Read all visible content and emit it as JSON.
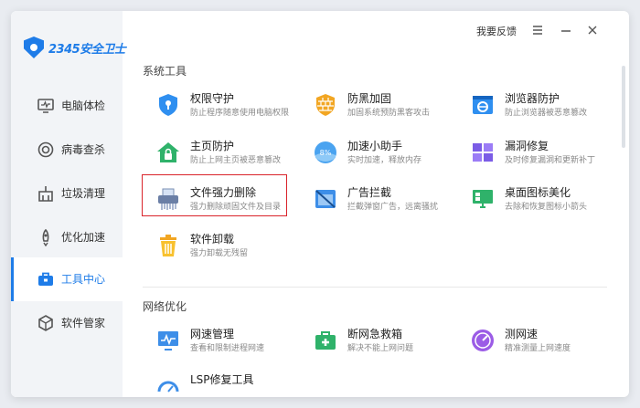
{
  "app": {
    "logo_text": "2345安全卫士"
  },
  "topbar": {
    "feedback": "我要反馈",
    "menu_icon": "menu-icon",
    "minimize_icon": "minimize-icon",
    "close_icon": "close-icon"
  },
  "sidebar": {
    "items": [
      {
        "label": "电脑体检",
        "icon": "monitor-icon"
      },
      {
        "label": "病毒查杀",
        "icon": "target-icon"
      },
      {
        "label": "垃圾清理",
        "icon": "broom-icon"
      },
      {
        "label": "优化加速",
        "icon": "rocket-icon"
      },
      {
        "label": "工具中心",
        "icon": "toolbox-icon",
        "active": true
      },
      {
        "label": "软件管家",
        "icon": "cube-icon"
      }
    ]
  },
  "sections": [
    {
      "title": "系统工具",
      "tools": [
        {
          "name": "权限守护",
          "desc": "防止程序随意使用电脑权限",
          "icon": "shield-lock-icon"
        },
        {
          "name": "防黑加固",
          "desc": "加固系统预防黑客攻击",
          "icon": "brick-wall-icon"
        },
        {
          "name": "浏览器防护",
          "desc": "防止浏览器被恶意篡改",
          "icon": "browser-shield-icon"
        },
        {
          "name": "主页防护",
          "desc": "防止上网主页被恶意篡改",
          "icon": "home-lock-icon"
        },
        {
          "name": "加速小助手",
          "desc": "实时加速，释放内存",
          "icon": "speed-ball-icon"
        },
        {
          "name": "漏洞修复",
          "desc": "及时修复漏洞和更新补丁",
          "icon": "windows-patch-icon"
        },
        {
          "name": "文件强力删除",
          "desc": "强力删除顽固文件及目录",
          "icon": "shredder-icon"
        },
        {
          "name": "广告拦截",
          "desc": "拦截弹窗广告，远离骚扰",
          "icon": "ad-block-icon"
        },
        {
          "name": "桌面图标美化",
          "desc": "去除和恢复图标小箭头",
          "icon": "desktop-monitor-icon"
        },
        {
          "name": "软件卸载",
          "desc": "强力卸载无残留",
          "icon": "trash-bin-icon"
        }
      ]
    },
    {
      "title": "网络优化",
      "tools": [
        {
          "name": "网速管理",
          "desc": "查看和限制进程网速",
          "icon": "network-monitor-icon"
        },
        {
          "name": "断网急救箱",
          "desc": "解决不能上网问题",
          "icon": "first-aid-kit-icon"
        },
        {
          "name": "测网速",
          "desc": "精准测量上网速度",
          "icon": "speedometer-icon"
        },
        {
          "name": "LSP修复工具",
          "desc": "",
          "icon": "repair-gauge-icon"
        }
      ]
    }
  ],
  "colors": {
    "accent": "#1e7ce8",
    "highlight_border": "#d9232a"
  }
}
